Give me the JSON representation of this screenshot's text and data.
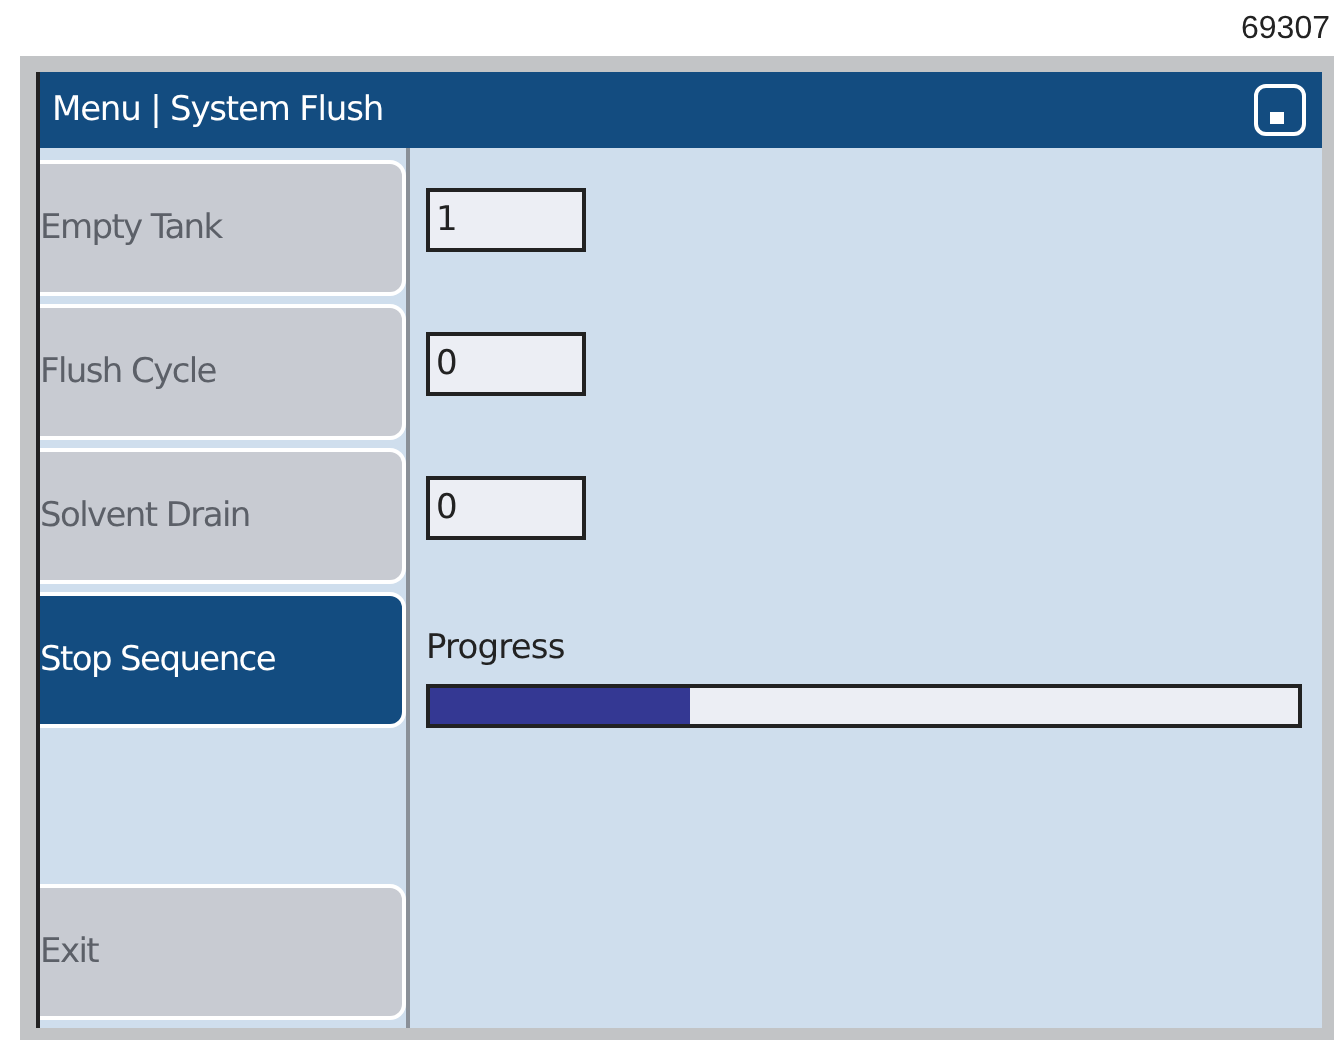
{
  "figure_number": "69307",
  "window": {
    "title": "Menu | System Flush"
  },
  "sidebar": {
    "items": [
      {
        "label": "Empty Tank",
        "selected": false,
        "disabled": true
      },
      {
        "label": "Flush Cycle",
        "selected": false,
        "disabled": true
      },
      {
        "label": "Solvent Drain",
        "selected": false,
        "disabled": true
      },
      {
        "label": "Stop Sequence",
        "selected": true,
        "disabled": false
      }
    ],
    "exit": {
      "label": "Exit",
      "disabled": true
    }
  },
  "fields": [
    {
      "value": "1"
    },
    {
      "value": "0"
    },
    {
      "value": "0"
    }
  ],
  "progress": {
    "label": "Progress",
    "level": 0.3
  }
}
